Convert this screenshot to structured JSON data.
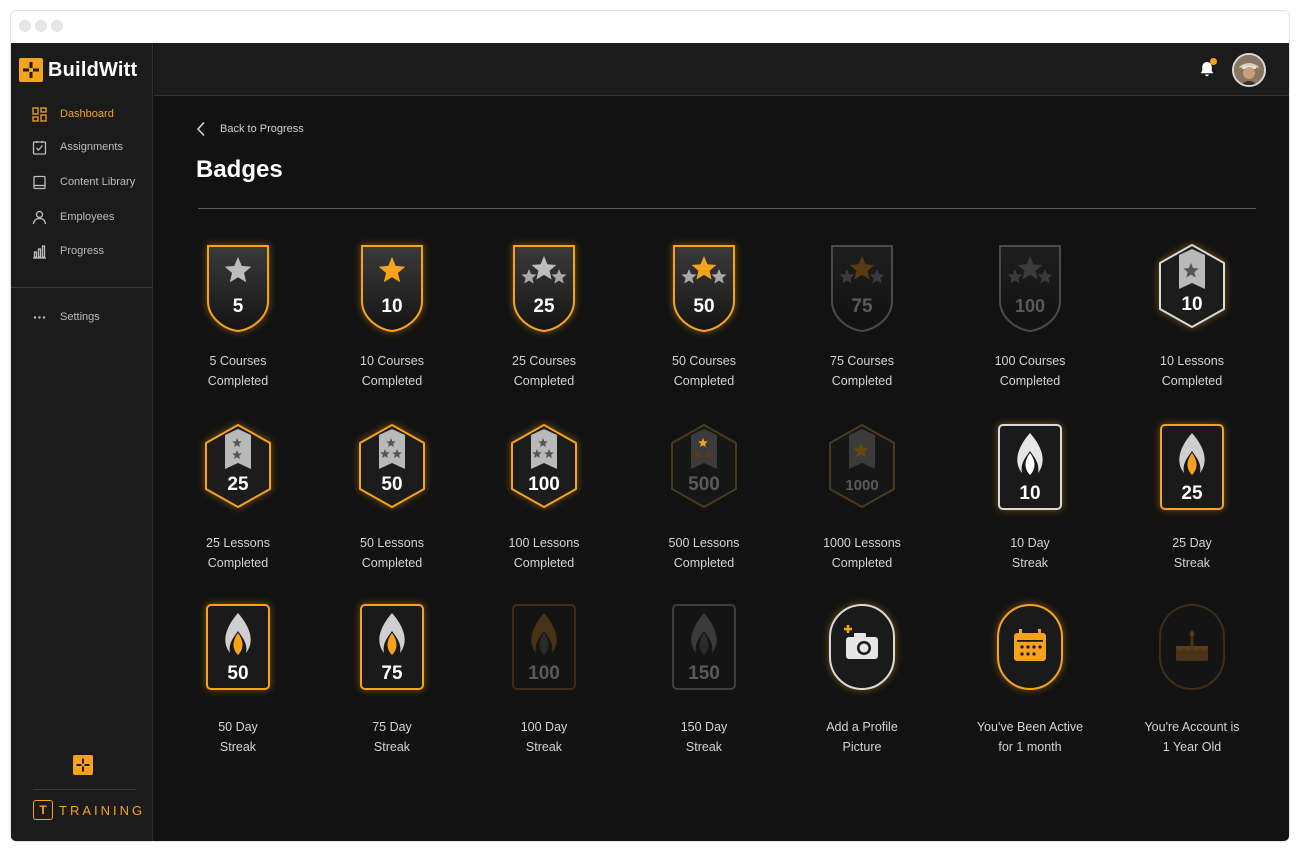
{
  "app": {
    "brand": "BuildWitt",
    "product": "TRAINING",
    "colors": {
      "accent": "#f7a21b",
      "background": "#121212",
      "sidebar": "#1b1b1b"
    }
  },
  "sidebar": {
    "items": [
      {
        "label": "Dashboard",
        "icon": "dashboard-icon",
        "active": true
      },
      {
        "label": "Assignments",
        "icon": "clipboard-check-icon",
        "active": false
      },
      {
        "label": "Content Library",
        "icon": "book-icon",
        "active": false
      },
      {
        "label": "Employees",
        "icon": "person-icon",
        "active": false
      },
      {
        "label": "Progress",
        "icon": "bar-chart-icon",
        "active": false
      }
    ],
    "settings": {
      "label": "Settings",
      "icon": "more-dots-icon"
    }
  },
  "header": {
    "notifications_icon": "bell-icon",
    "has_unread": true,
    "avatar_icon": "user-avatar"
  },
  "main": {
    "back_label": "Back to Progress",
    "title": "Badges",
    "badges": [
      {
        "line1": "5 Courses",
        "line2": "Completed",
        "number": "5",
        "type": "shield",
        "stars": 1,
        "center": "gray",
        "earned": true
      },
      {
        "line1": "10 Courses",
        "line2": "Completed",
        "number": "10",
        "type": "shield",
        "stars": 1,
        "center": "orange",
        "earned": true
      },
      {
        "line1": "25 Courses",
        "line2": "Completed",
        "number": "25",
        "type": "shield",
        "stars": 3,
        "center": "gray",
        "earned": true
      },
      {
        "line1": "50 Courses",
        "line2": "Completed",
        "number": "50",
        "type": "shield",
        "stars": 3,
        "center": "orange",
        "earned": true
      },
      {
        "line1": "75 Courses",
        "line2": "Completed",
        "number": "75",
        "type": "shield",
        "stars": 3,
        "center": "orange",
        "earned": false
      },
      {
        "line1": "100 Courses",
        "line2": "Completed",
        "number": "100",
        "type": "shield",
        "stars": 3,
        "center": "gray",
        "earned": false
      },
      {
        "line1": "10 Lessons",
        "line2": "Completed",
        "number": "10",
        "type": "hexagon",
        "stars": 1,
        "ring": "silver",
        "earned": true
      },
      {
        "line1": "25 Lessons",
        "line2": "Completed",
        "number": "25",
        "type": "hexagon",
        "stars": 2,
        "ring": "orange",
        "earned": true
      },
      {
        "line1": "50 Lessons",
        "line2": "Completed",
        "number": "50",
        "type": "hexagon",
        "stars": 3,
        "ring": "orange",
        "earned": true
      },
      {
        "line1": "100 Lessons",
        "line2": "Completed",
        "number": "100",
        "type": "hexagon",
        "stars": 3,
        "ring": "orange",
        "earned": true
      },
      {
        "line1": "500 Lessons",
        "line2": "Completed",
        "number": "500",
        "type": "hexagon",
        "stars": 3,
        "ring": "orange",
        "earned": false
      },
      {
        "line1": "1000 Lessons",
        "line2": "Completed",
        "number": "1000",
        "type": "hexagon",
        "stars": 1,
        "ring": "orange",
        "earned": false
      },
      {
        "line1": "10 Day",
        "line2": "Streak",
        "number": "10",
        "type": "flame",
        "flame": "white",
        "ring": "silver",
        "earned": true
      },
      {
        "line1": "25 Day",
        "line2": "Streak",
        "number": "25",
        "type": "flame",
        "flame": "orange",
        "ring": "orange",
        "earned": true
      },
      {
        "line1": "50 Day",
        "line2": "Streak",
        "number": "50",
        "type": "flame",
        "flame": "orange",
        "ring": "orange",
        "earned": true
      },
      {
        "line1": "75 Day",
        "line2": "Streak",
        "number": "75",
        "type": "flame",
        "flame": "orange",
        "ring": "orange",
        "earned": true
      },
      {
        "line1": "100 Day",
        "line2": "Streak",
        "number": "100",
        "type": "flame",
        "flame": "orange",
        "ring": "orange",
        "earned": false
      },
      {
        "line1": "150 Day",
        "line2": "Streak",
        "number": "150",
        "type": "flame",
        "flame": "gray",
        "ring": "gray",
        "earned": false
      },
      {
        "line1": "Add a Profile",
        "line2": "Picture",
        "number": "",
        "type": "pill",
        "icon": "camera-plus-icon",
        "ring": "silver",
        "earned": true
      },
      {
        "line1": "You've Been Active",
        "line2": "for 1 month",
        "number": "",
        "type": "pill",
        "icon": "calendar-icon",
        "ring": "orange",
        "earned": true
      },
      {
        "line1": "You're Account is",
        "line2": "1 Year Old",
        "number": "",
        "type": "pill",
        "icon": "cake-icon",
        "ring": "orange",
        "earned": false
      }
    ]
  }
}
